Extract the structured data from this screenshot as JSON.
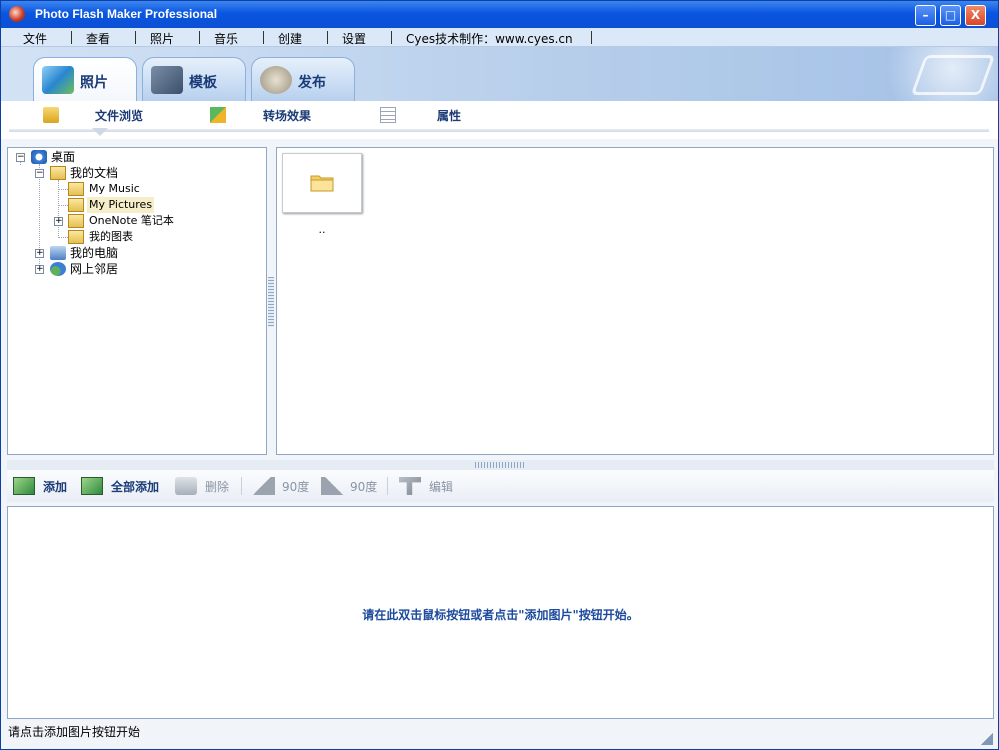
{
  "window": {
    "title": "Photo Flash Maker Professional",
    "min": "–",
    "max": "□",
    "close": "X"
  },
  "menu": [
    "文件",
    "查看",
    "照片",
    "音乐",
    "创建",
    "设置",
    "Cyes技术制作：www.cyes.cn"
  ],
  "tabs": [
    {
      "label": "照片",
      "active": true,
      "icon": "photos-icon"
    },
    {
      "label": "模板",
      "active": false,
      "icon": "template-icon"
    },
    {
      "label": "发布",
      "active": false,
      "icon": "publish-icon"
    }
  ],
  "subtabs": [
    {
      "label": "文件浏览",
      "icon": "file-browse-icon",
      "active": true
    },
    {
      "label": "转场效果",
      "icon": "transition-icon",
      "active": false
    },
    {
      "label": "属性",
      "icon": "properties-icon",
      "active": false
    }
  ],
  "tree": {
    "desktop": "桌面",
    "my_documents": "我的文档",
    "my_music": "My Music",
    "my_pictures": "My Pictures",
    "onenote": "OneNote 笔记本",
    "my_charts": "我的图表",
    "my_computer": "我的电脑",
    "network": "网上邻居"
  },
  "files": [
    {
      "label": ".."
    }
  ],
  "toolbar": {
    "add": "添加",
    "add_all": "全部添加",
    "delete": "删除",
    "rotate_left": "90度",
    "rotate_right": "90度",
    "edit": "编辑"
  },
  "drop_hint": "请在此双击鼠标按钮或者点击\"添加图片\"按钮开始。",
  "status": "请点击添加图片按钮开始",
  "colors": {
    "titlebar": "#0b4fd4",
    "accent_text": "#1b3b77",
    "hint_text": "#1c4a9c"
  }
}
